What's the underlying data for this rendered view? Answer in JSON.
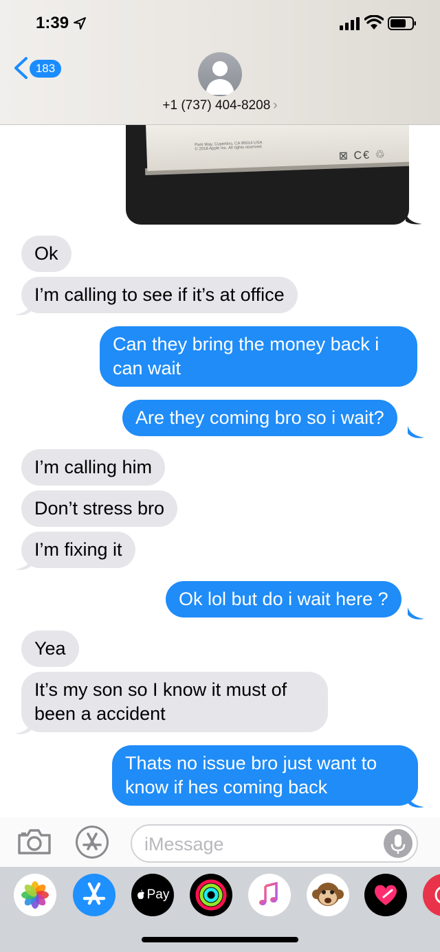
{
  "status_bar": {
    "time": "1:39"
  },
  "header": {
    "back_count": "183",
    "contact": "+1 (737) 404-8208",
    "contact_chevron": "›"
  },
  "photo": {
    "fineprint_1": "Park Way, Cupertino, CA 95014 USA",
    "fineprint_2": "© 2018 Apple Inc. All rights reserved.",
    "marks": "⊠ C€ ♲"
  },
  "messages": [
    {
      "from": "them",
      "text": "Ok"
    },
    {
      "from": "them",
      "text": "I’m calling to see if it’s at office"
    },
    {
      "from": "me",
      "text": "Can they bring the money back i can wait"
    },
    {
      "from": "me",
      "text": "Are they coming bro so i wait?"
    },
    {
      "from": "them",
      "text": "I’m calling him"
    },
    {
      "from": "them",
      "text": "Don’t stress bro"
    },
    {
      "from": "them",
      "text": "I’m fixing it"
    },
    {
      "from": "me",
      "text": "Ok lol but do i wait here ?"
    },
    {
      "from": "them",
      "text": "Yea"
    },
    {
      "from": "them",
      "text": "It’s my son so I know it must of been a accident"
    },
    {
      "from": "me",
      "text": "Thats no issue bro just want to know if hes coming back"
    }
  ],
  "compose": {
    "placeholder": "iMessage"
  },
  "app_drawer": {
    "apps": [
      "photos-app",
      "app-store-app",
      "apple-pay-app",
      "activity-app",
      "music-app",
      "animoji-app",
      "digital-touch-app",
      "search-app"
    ],
    "apple_pay_label": "Pay"
  },
  "colors": {
    "outgoing_bubble": "#1f8cf7",
    "incoming_bubble": "#e5e5ea",
    "badge": "#1a8cff"
  }
}
